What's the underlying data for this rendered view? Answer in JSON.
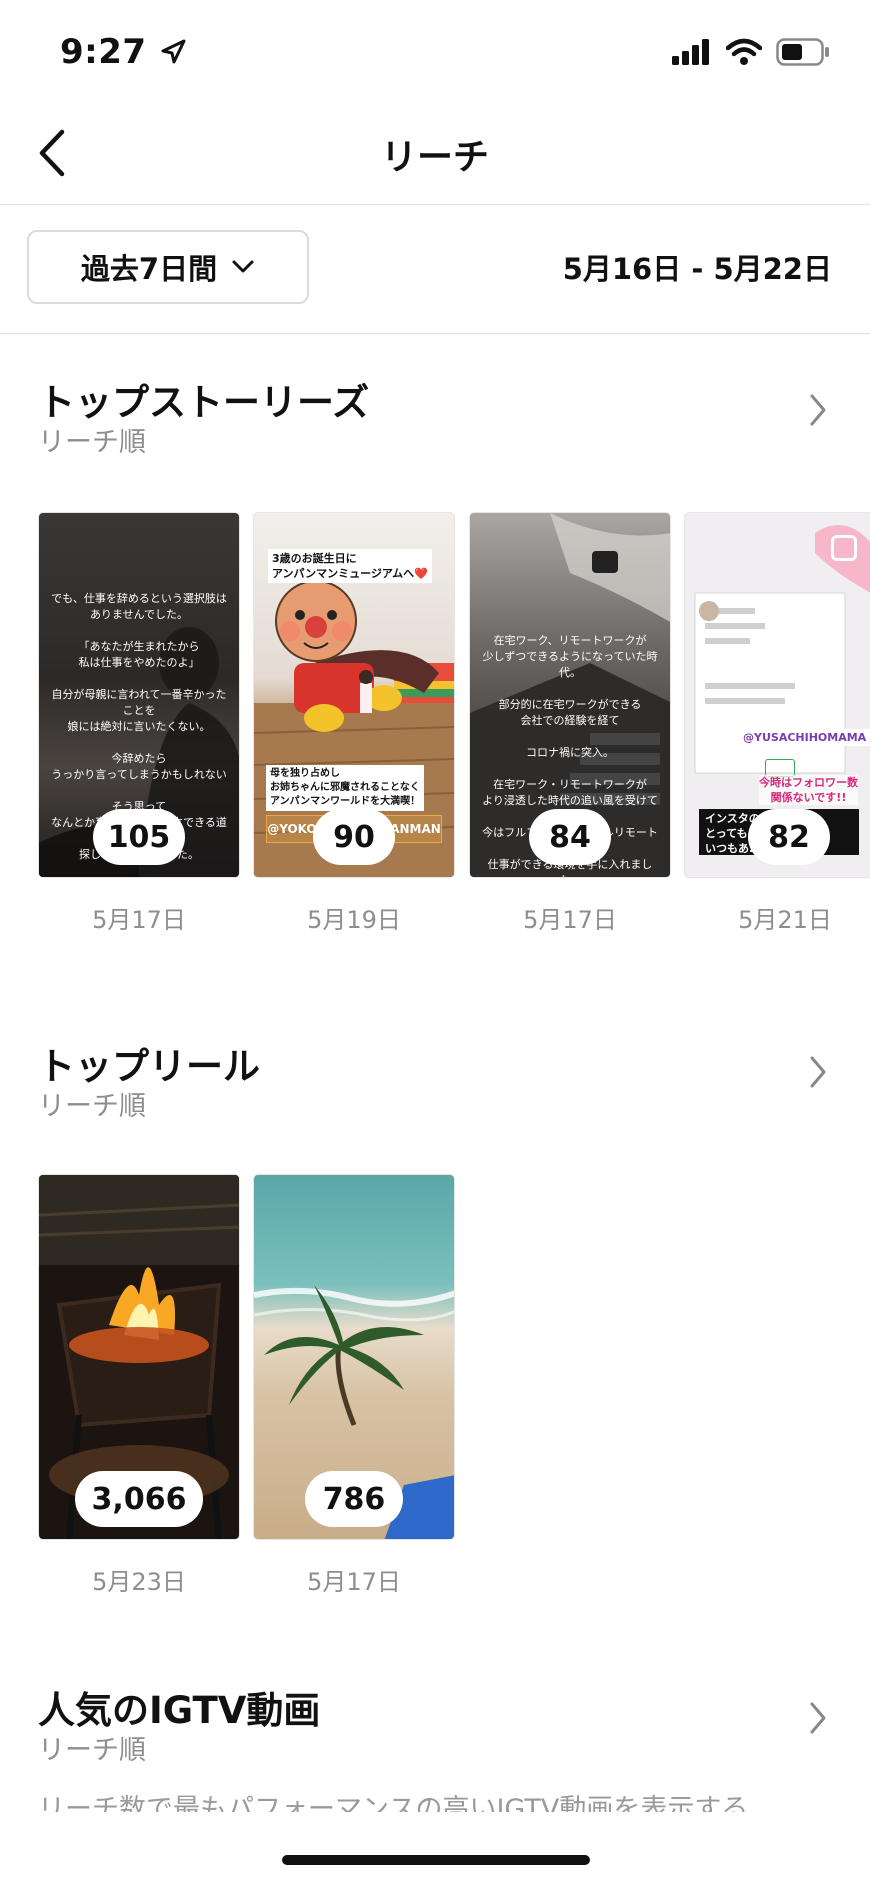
{
  "status_bar": {
    "time": "9:27"
  },
  "header": {
    "title": "リーチ"
  },
  "date_filter": {
    "range_label": "過去7日間",
    "date_range": "5月16日 - 5月22日"
  },
  "top_stories": {
    "title": "トップストーリーズ",
    "subtitle": "リーチ順",
    "items": [
      {
        "count": "105",
        "date": "5月17日",
        "lines": [
          "でも、仕事を辞めるという選択肢は",
          "ありませんでした。",
          "",
          "「あなたが生まれたから",
          "私は仕事をやめたのよ」",
          "",
          "自分が母親に言われて一番辛かったことを",
          "娘には絶対に言いたくない。",
          "",
          "今辞めたら",
          "うっかり言ってしまうかもしれない",
          "",
          "そう思って",
          "なんとか育児と仕事を両立できる道を",
          "探しつづけてきました。"
        ]
      },
      {
        "count": "90",
        "date": "5月19日",
        "caption_top": "3歳のお誕生日に\nアンパンマンミュージアムへ❤️",
        "caption_bottom": "母を独り占めし\nお姉ちゃんに邪魔されることなく\nアンパンマンワールドを大満喫！",
        "tag": "@YOKOHAMA_ANPANMAN"
      },
      {
        "count": "84",
        "date": "5月17日",
        "lines": [
          "在宅ワーク、リモートワークが",
          "少しずつできるようになっていた時代。",
          "",
          "部分的に在宅ワークができる",
          "会社での経験を経て",
          "",
          "コロナ禍に突入。",
          "",
          "在宅ワーク・リモートワークが",
          "より浸透した時代の追い風を受けて",
          "",
          "今はフルフレックス・フルリモートで",
          "仕事ができる環境を手に入れました。"
        ]
      },
      {
        "count": "82",
        "date": "5月21日",
        "handle": "@YUSACHIHOMAMA",
        "pink_text": "今時はフォロワー数\n関係ないです!!",
        "sticker": "インスタの\nとっても\nいつもあ...す🍀"
      }
    ]
  },
  "top_reels": {
    "title": "トップリール",
    "subtitle": "リーチ順",
    "items": [
      {
        "count": "3,066",
        "date": "5月23日"
      },
      {
        "count": "786",
        "date": "5月17日"
      }
    ]
  },
  "igtv": {
    "title": "人気のIGTV動画",
    "subtitle": "リーチ順",
    "description": "リーチ数で最もパフォーマンスの高いIGTV動画を表示する"
  }
}
